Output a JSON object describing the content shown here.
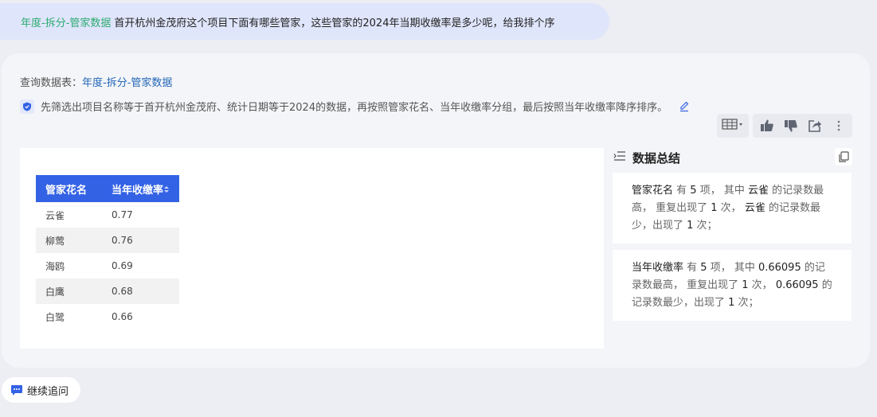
{
  "question": {
    "tag": "年度-拆分-管家数据",
    "text": "首开杭州金茂府这个项目下面有哪些管家，这些管家的2024年当期收缴率是多少呢，给我排个序"
  },
  "answer": {
    "source_prefix": "查询数据表：",
    "source_table": "年度-拆分-管家数据",
    "description": "先筛选出项目名称等于首开杭州金茂府、统计日期等于2024的数据，再按照管家花名、当年收缴率分组，最后按照当年收缴率降序排序。",
    "table": {
      "headers": [
        "管家花名",
        "当年收缴率"
      ],
      "rows": [
        [
          "云雀",
          "0.77"
        ],
        [
          "柳莺",
          "0.76"
        ],
        [
          "海鸥",
          "0.69"
        ],
        [
          "白鹰",
          "0.68"
        ],
        [
          "白鹭",
          "0.66"
        ]
      ]
    },
    "summary": {
      "title": "数据总结",
      "card1": {
        "field": "管家花名",
        "t1": " 有 ",
        "count": "5",
        "t2": " 项， 其中 ",
        "val": "云雀",
        "t3": " 的记录数最高， 重复出现了 ",
        "times": "1",
        "t4": " 次， ",
        "val2": "云雀",
        "t5": " 的记录数最少，出现了 ",
        "times2": "1",
        "t6": " 次；"
      },
      "card2": {
        "field": "当年收缴率",
        "t1": " 有 ",
        "count": "5",
        "t2": " 项， 其中 ",
        "val": "0.66095",
        "t3": " 的记录数最高， 重复出现了 ",
        "times": "1",
        "t4": " 次， ",
        "val2": "0.66095",
        "t5": " 的记录数最少，出现了 ",
        "times2": "1",
        "t6": " 次；"
      }
    }
  },
  "followup": {
    "label": "继续追问"
  },
  "colors": {
    "accent": "#3362e5",
    "tag": "#2eaa72",
    "link": "#2467b8"
  },
  "icons": [
    "shield-icon",
    "edit-icon",
    "table-view-icon",
    "thumbs-up-icon",
    "thumbs-down-icon",
    "share-icon",
    "more-icon",
    "list-icon",
    "copy-icon",
    "chat-icon"
  ]
}
